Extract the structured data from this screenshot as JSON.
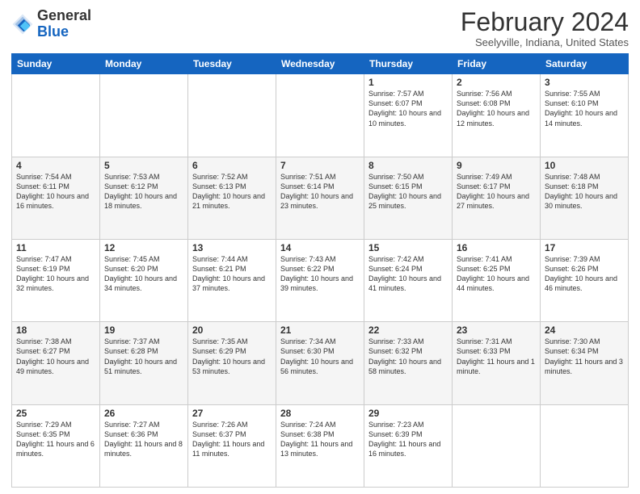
{
  "header": {
    "logo_general": "General",
    "logo_blue": "Blue",
    "month_title": "February 2024",
    "location": "Seelyville, Indiana, United States"
  },
  "days_of_week": [
    "Sunday",
    "Monday",
    "Tuesday",
    "Wednesday",
    "Thursday",
    "Friday",
    "Saturday"
  ],
  "weeks": [
    [
      {
        "day": "",
        "info": ""
      },
      {
        "day": "",
        "info": ""
      },
      {
        "day": "",
        "info": ""
      },
      {
        "day": "",
        "info": ""
      },
      {
        "day": "1",
        "info": "Sunrise: 7:57 AM\nSunset: 6:07 PM\nDaylight: 10 hours\nand 10 minutes."
      },
      {
        "day": "2",
        "info": "Sunrise: 7:56 AM\nSunset: 6:08 PM\nDaylight: 10 hours\nand 12 minutes."
      },
      {
        "day": "3",
        "info": "Sunrise: 7:55 AM\nSunset: 6:10 PM\nDaylight: 10 hours\nand 14 minutes."
      }
    ],
    [
      {
        "day": "4",
        "info": "Sunrise: 7:54 AM\nSunset: 6:11 PM\nDaylight: 10 hours\nand 16 minutes."
      },
      {
        "day": "5",
        "info": "Sunrise: 7:53 AM\nSunset: 6:12 PM\nDaylight: 10 hours\nand 18 minutes."
      },
      {
        "day": "6",
        "info": "Sunrise: 7:52 AM\nSunset: 6:13 PM\nDaylight: 10 hours\nand 21 minutes."
      },
      {
        "day": "7",
        "info": "Sunrise: 7:51 AM\nSunset: 6:14 PM\nDaylight: 10 hours\nand 23 minutes."
      },
      {
        "day": "8",
        "info": "Sunrise: 7:50 AM\nSunset: 6:15 PM\nDaylight: 10 hours\nand 25 minutes."
      },
      {
        "day": "9",
        "info": "Sunrise: 7:49 AM\nSunset: 6:17 PM\nDaylight: 10 hours\nand 27 minutes."
      },
      {
        "day": "10",
        "info": "Sunrise: 7:48 AM\nSunset: 6:18 PM\nDaylight: 10 hours\nand 30 minutes."
      }
    ],
    [
      {
        "day": "11",
        "info": "Sunrise: 7:47 AM\nSunset: 6:19 PM\nDaylight: 10 hours\nand 32 minutes."
      },
      {
        "day": "12",
        "info": "Sunrise: 7:45 AM\nSunset: 6:20 PM\nDaylight: 10 hours\nand 34 minutes."
      },
      {
        "day": "13",
        "info": "Sunrise: 7:44 AM\nSunset: 6:21 PM\nDaylight: 10 hours\nand 37 minutes."
      },
      {
        "day": "14",
        "info": "Sunrise: 7:43 AM\nSunset: 6:22 PM\nDaylight: 10 hours\nand 39 minutes."
      },
      {
        "day": "15",
        "info": "Sunrise: 7:42 AM\nSunset: 6:24 PM\nDaylight: 10 hours\nand 41 minutes."
      },
      {
        "day": "16",
        "info": "Sunrise: 7:41 AM\nSunset: 6:25 PM\nDaylight: 10 hours\nand 44 minutes."
      },
      {
        "day": "17",
        "info": "Sunrise: 7:39 AM\nSunset: 6:26 PM\nDaylight: 10 hours\nand 46 minutes."
      }
    ],
    [
      {
        "day": "18",
        "info": "Sunrise: 7:38 AM\nSunset: 6:27 PM\nDaylight: 10 hours\nand 49 minutes."
      },
      {
        "day": "19",
        "info": "Sunrise: 7:37 AM\nSunset: 6:28 PM\nDaylight: 10 hours\nand 51 minutes."
      },
      {
        "day": "20",
        "info": "Sunrise: 7:35 AM\nSunset: 6:29 PM\nDaylight: 10 hours\nand 53 minutes."
      },
      {
        "day": "21",
        "info": "Sunrise: 7:34 AM\nSunset: 6:30 PM\nDaylight: 10 hours\nand 56 minutes."
      },
      {
        "day": "22",
        "info": "Sunrise: 7:33 AM\nSunset: 6:32 PM\nDaylight: 10 hours\nand 58 minutes."
      },
      {
        "day": "23",
        "info": "Sunrise: 7:31 AM\nSunset: 6:33 PM\nDaylight: 11 hours\nand 1 minute."
      },
      {
        "day": "24",
        "info": "Sunrise: 7:30 AM\nSunset: 6:34 PM\nDaylight: 11 hours\nand 3 minutes."
      }
    ],
    [
      {
        "day": "25",
        "info": "Sunrise: 7:29 AM\nSunset: 6:35 PM\nDaylight: 11 hours\nand 6 minutes."
      },
      {
        "day": "26",
        "info": "Sunrise: 7:27 AM\nSunset: 6:36 PM\nDaylight: 11 hours\nand 8 minutes."
      },
      {
        "day": "27",
        "info": "Sunrise: 7:26 AM\nSunset: 6:37 PM\nDaylight: 11 hours\nand 11 minutes."
      },
      {
        "day": "28",
        "info": "Sunrise: 7:24 AM\nSunset: 6:38 PM\nDaylight: 11 hours\nand 13 minutes."
      },
      {
        "day": "29",
        "info": "Sunrise: 7:23 AM\nSunset: 6:39 PM\nDaylight: 11 hours\nand 16 minutes."
      },
      {
        "day": "",
        "info": ""
      },
      {
        "day": "",
        "info": ""
      }
    ]
  ]
}
